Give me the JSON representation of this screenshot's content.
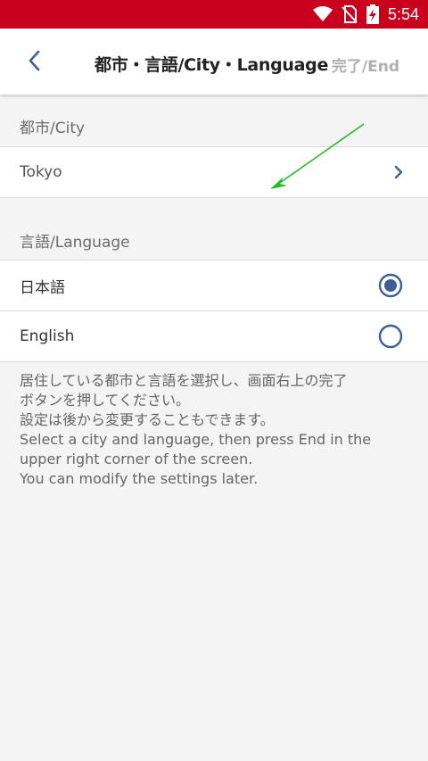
{
  "status_bar": {
    "time": "5:54",
    "icons": [
      "wifi-icon",
      "no-sim-icon",
      "battery-charging-icon"
    ]
  },
  "header": {
    "back_icon": "chevron-left-icon",
    "title": "都市・言語/City・Language",
    "done_label": "完了/End"
  },
  "city_section": {
    "header": "都市/City",
    "selected_city": "Tokyo",
    "chevron_icon": "chevron-right-icon"
  },
  "language_section": {
    "header": "言語/Language",
    "options": [
      {
        "label": "日本語",
        "selected": true
      },
      {
        "label": "English",
        "selected": false
      }
    ]
  },
  "note_lines": [
    "居住している都市と言語を選択し、画面右上の完了",
    "ボタンを押してください。",
    "設定は後から変更することもできます。",
    "Select a city and language, then press End in the",
    "upper right corner of the screen.",
    "You can modify the settings later."
  ],
  "colors": {
    "status_bar": "#c8001e",
    "accent": "#3d5f99",
    "annotation_arrow": "#22bb22"
  }
}
